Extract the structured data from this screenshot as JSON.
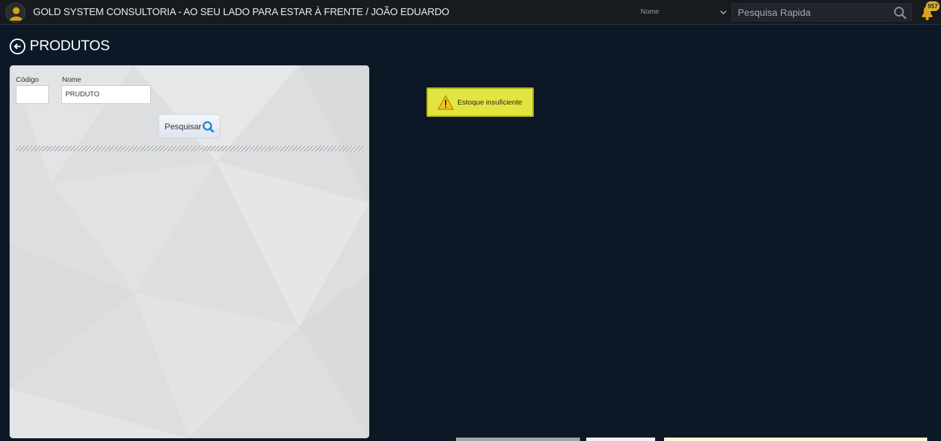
{
  "header": {
    "title": "GOLD SYSTEM CONSULTORIA - AO SEU LADO PARA ESTAR À FRENTE / JOÃO EDUARDO",
    "search_field_select": "Nome",
    "quick_search_placeholder": "Pesquisa Rapida",
    "notification_count": "957",
    "icons": [
      "user-avatar-icon",
      "chevron-down-icon",
      "search-icon",
      "bell-icon"
    ]
  },
  "page": {
    "title": "PRODUTOS",
    "back_icon": "arrow-left-circle-icon"
  },
  "filters": {
    "codigo_label": "Código",
    "codigo_value": "",
    "nome_label": "Nome",
    "nome_value": "PRUDUTO",
    "search_button_label": "Pesquisar"
  },
  "toast": {
    "message": "Estoque insuficiente",
    "icon": "warning-icon",
    "color": "#e2e53f"
  },
  "colors": {
    "background": "#0d1827",
    "topbar": "#171a1f",
    "accent": "#d4b43a"
  }
}
